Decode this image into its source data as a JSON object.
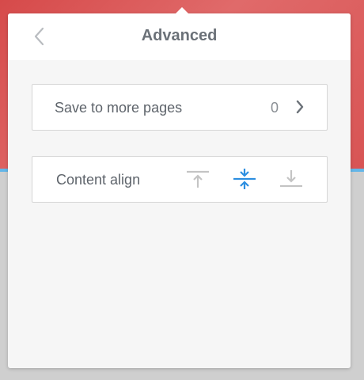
{
  "panel": {
    "title": "Advanced",
    "back_icon": "chevron-left-icon"
  },
  "save_to_pages": {
    "label": "Save to more pages",
    "count": "0",
    "icon": "chevron-right-icon"
  },
  "content_align": {
    "label": "Content align",
    "options": [
      {
        "name": "top",
        "icon": "align-top-icon",
        "selected": false
      },
      {
        "name": "center",
        "icon": "align-center-icon",
        "selected": true
      },
      {
        "name": "bottom",
        "icon": "align-bottom-icon",
        "selected": false
      }
    ]
  },
  "colors": {
    "accent": "#2d8fe0",
    "inactive_icon": "#c4c4c4",
    "text": "#5e646b",
    "background_top": "#d64a4a",
    "background_bottom": "#cfcfcf"
  }
}
